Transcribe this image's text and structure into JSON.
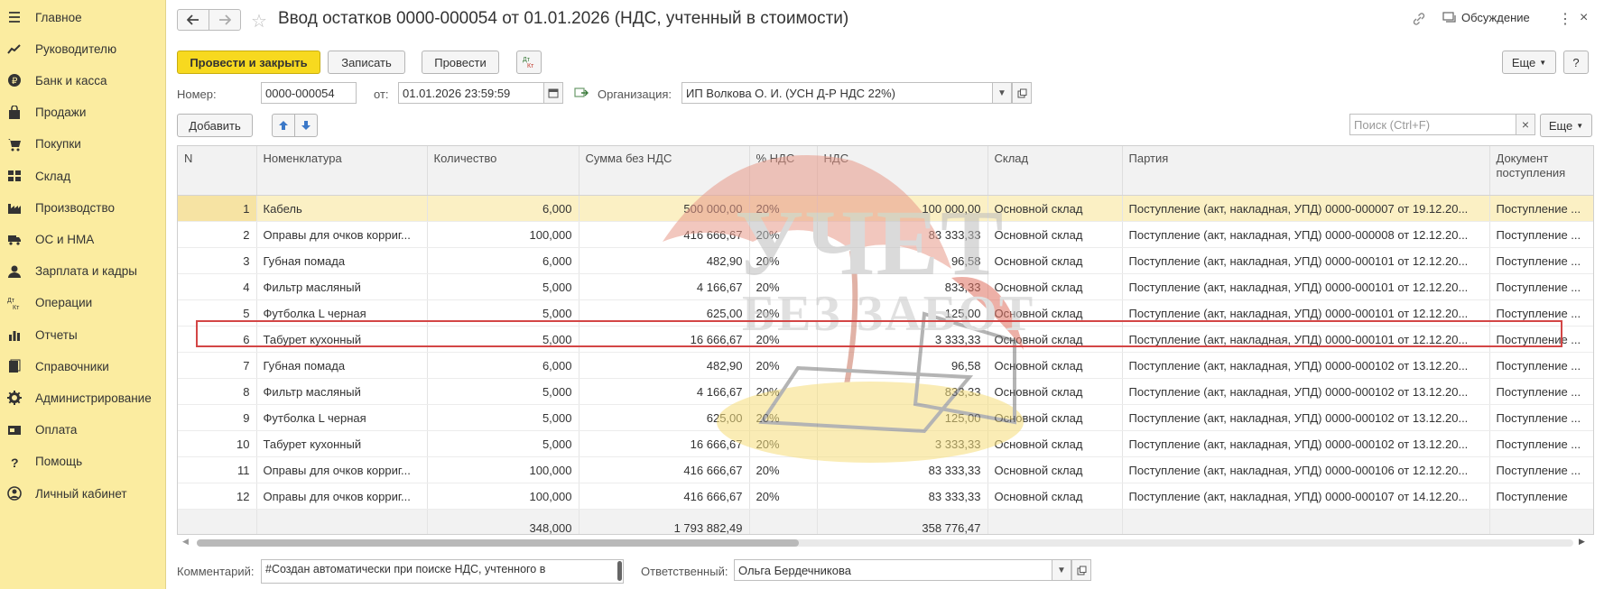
{
  "sidebar": {
    "items": [
      {
        "label": "Главное",
        "icon": "menu-icon"
      },
      {
        "label": "Руководителю",
        "icon": "chart-line-icon"
      },
      {
        "label": "Банк и касса",
        "icon": "coin-icon"
      },
      {
        "label": "Продажи",
        "icon": "shopping-bag-icon"
      },
      {
        "label": "Покупки",
        "icon": "cart-icon"
      },
      {
        "label": "Склад",
        "icon": "warehouse-icon"
      },
      {
        "label": "Производство",
        "icon": "factory-icon"
      },
      {
        "label": "ОС и НМА",
        "icon": "truck-icon"
      },
      {
        "label": "Зарплата и кадры",
        "icon": "person-icon"
      },
      {
        "label": "Операции",
        "icon": "dt-kt-icon"
      },
      {
        "label": "Отчеты",
        "icon": "bar-chart-icon"
      },
      {
        "label": "Справочники",
        "icon": "books-icon"
      },
      {
        "label": "Администрирование",
        "icon": "gear-icon"
      },
      {
        "label": "Оплата",
        "icon": "payment-icon"
      },
      {
        "label": "Помощь",
        "icon": "question-icon"
      },
      {
        "label": "Личный кабинет",
        "icon": "user-circle-icon"
      }
    ]
  },
  "header": {
    "title": "Ввод остатков 0000-000054 от 01.01.2026 (НДС, учтенный в стоимости)",
    "discussion_label": "Обсуждение"
  },
  "toolbar": {
    "post_close_label": "Провести и закрыть",
    "save_label": "Записать",
    "post_label": "Провести",
    "dtkt_label": "Дт Кт",
    "more_label": "Еще",
    "help_label": "?"
  },
  "form": {
    "number_label": "Номер:",
    "number_value": "0000-000054",
    "date_label": "от:",
    "date_value": "01.01.2026 23:59:59",
    "org_label": "Организация:",
    "org_value": "ИП Волкова О. И. (УСН Д-Р НДС 22%)"
  },
  "table_toolbar": {
    "add_label": "Добавить",
    "search_placeholder": "Поиск (Ctrl+F)",
    "search_clear": "×",
    "more_label": "Еще"
  },
  "table": {
    "columns": [
      "N",
      "Номенклатура",
      "Количество",
      "Сумма без НДС",
      "% НДС",
      "НДС",
      "Склад",
      "Партия",
      "Документ поступления"
    ],
    "rows": [
      [
        "1",
        "Кабель",
        "6,000",
        "500 000,00",
        "20%",
        "100 000,00",
        "Основной склад",
        "Поступление (акт, накладная, УПД) 0000-000007 от 19.12.20...",
        "Поступление ..."
      ],
      [
        "2",
        "Оправы для очков корриг...",
        "100,000",
        "416 666,67",
        "20%",
        "83 333,33",
        "Основной склад",
        "Поступление (акт, накладная, УПД) 0000-000008 от 12.12.20...",
        "Поступление ..."
      ],
      [
        "3",
        "Губная помада",
        "6,000",
        "482,90",
        "20%",
        "96,58",
        "Основной склад",
        "Поступление (акт, накладная, УПД) 0000-000101 от 12.12.20...",
        "Поступление ..."
      ],
      [
        "4",
        "Фильтр масляный",
        "5,000",
        "4 166,67",
        "20%",
        "833,33",
        "Основной склад",
        "Поступление (акт, накладная, УПД) 0000-000101 от 12.12.20...",
        "Поступление ..."
      ],
      [
        "5",
        "Футболка L черная",
        "5,000",
        "625,00",
        "20%",
        "125,00",
        "Основной склад",
        "Поступление (акт, накладная, УПД) 0000-000101 от 12.12.20...",
        "Поступление ..."
      ],
      [
        "6",
        "Табурет кухонный",
        "5,000",
        "16 666,67",
        "20%",
        "3 333,33",
        "Основной склад",
        "Поступление (акт, накладная, УПД) 0000-000101 от 12.12.20...",
        "Поступление ..."
      ],
      [
        "7",
        "Губная помада",
        "6,000",
        "482,90",
        "20%",
        "96,58",
        "Основной склад",
        "Поступление (акт, накладная, УПД) 0000-000102 от 13.12.20...",
        "Поступление ..."
      ],
      [
        "8",
        "Фильтр масляный",
        "5,000",
        "4 166,67",
        "20%",
        "833,33",
        "Основной склад",
        "Поступление (акт, накладная, УПД) 0000-000102 от 13.12.20...",
        "Поступление ..."
      ],
      [
        "9",
        "Футболка L черная",
        "5,000",
        "625,00",
        "20%",
        "125,00",
        "Основной склад",
        "Поступление (акт, накладная, УПД) 0000-000102 от 13.12.20...",
        "Поступление ..."
      ],
      [
        "10",
        "Табурет кухонный",
        "5,000",
        "16 666,67",
        "20%",
        "3 333,33",
        "Основной склад",
        "Поступление (акт, накладная, УПД) 0000-000102 от 13.12.20...",
        "Поступление ..."
      ],
      [
        "11",
        "Оправы для очков корриг...",
        "100,000",
        "416 666,67",
        "20%",
        "83 333,33",
        "Основной склад",
        "Поступление (акт, накладная, УПД) 0000-000106 от 12.12.20...",
        "Поступление ..."
      ],
      [
        "12",
        "Оправы для очков корриг...",
        "100,000",
        "416 666,67",
        "20%",
        "83 333,33",
        "Основной склад",
        "Поступление (акт, накладная, УПД) 0000-000107 от 14.12.20...",
        "Поступление"
      ]
    ],
    "totals": {
      "quantity": "348,000",
      "sum": "1 793 882,49",
      "vat": "358 776,47"
    }
  },
  "watermark": {
    "line1": "УЧЕТ",
    "line2": "БЕЗ ЗАБОТ"
  },
  "footer": {
    "comment_label": "Комментарий:",
    "comment_value": "#Создан автоматически при поиске НДС, учтенного в",
    "responsible_label": "Ответственный:",
    "responsible_value": "Ольга Бердечникова"
  },
  "colors": {
    "sidebar_bg": "#fbeca0",
    "primary_button": "#f7d91f",
    "highlight_border": "#d34646",
    "selected_row": "#fbf0c4"
  }
}
